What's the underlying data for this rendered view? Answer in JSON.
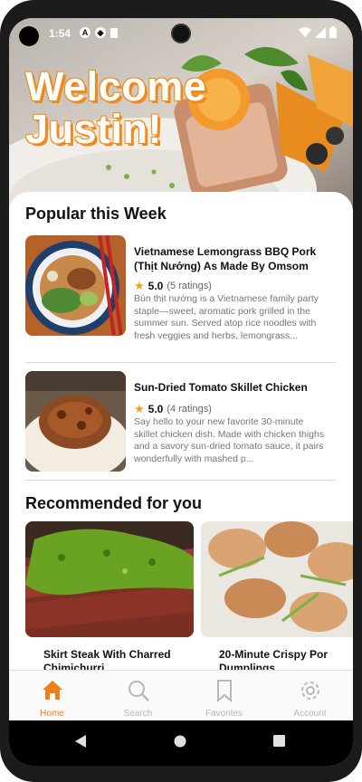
{
  "status_bar": {
    "time": "1:54"
  },
  "hero": {
    "line1": "Welcome",
    "line2": "Justin!"
  },
  "popular": {
    "title": "Popular this Week",
    "items": [
      {
        "title": "Vietnamese Lemongrass BBQ Pork (Thịt Nướng) As Made By Omsom",
        "rating": "5.0",
        "ratings_count": "(5 ratings)",
        "description": "Bún thịt nướng is a Vietnamese family party staple—sweet, aromatic pork grilled in the summer sun. Served atop rice noodles with fresh veggies and herbs, lemongrass..."
      },
      {
        "title": "Sun-Dried Tomato Skillet Chicken",
        "rating": "5.0",
        "ratings_count": "(4 ratings)",
        "description": "Say hello to your new favorite 30-minute skillet chicken dish. Made with chicken thighs and a savory sun-dried tomato sauce, it pairs wonderfully with mashed p..."
      }
    ]
  },
  "recommended": {
    "title": "Recommended for you",
    "items": [
      {
        "title": "Skirt Steak With Charred Chimichurri"
      },
      {
        "title": "20-Minute Crispy Por Dumplings"
      }
    ]
  },
  "nav": {
    "items": [
      {
        "label": "Home",
        "icon": "home-icon",
        "active": true
      },
      {
        "label": "Search",
        "icon": "search-icon",
        "active": false
      },
      {
        "label": "Favorites",
        "icon": "bookmark-icon",
        "active": false
      },
      {
        "label": "Account",
        "icon": "gear-icon",
        "active": false
      }
    ]
  },
  "colors": {
    "accent": "#ef7f1a",
    "star": "#f2a413",
    "muted": "#b8b8b8"
  }
}
